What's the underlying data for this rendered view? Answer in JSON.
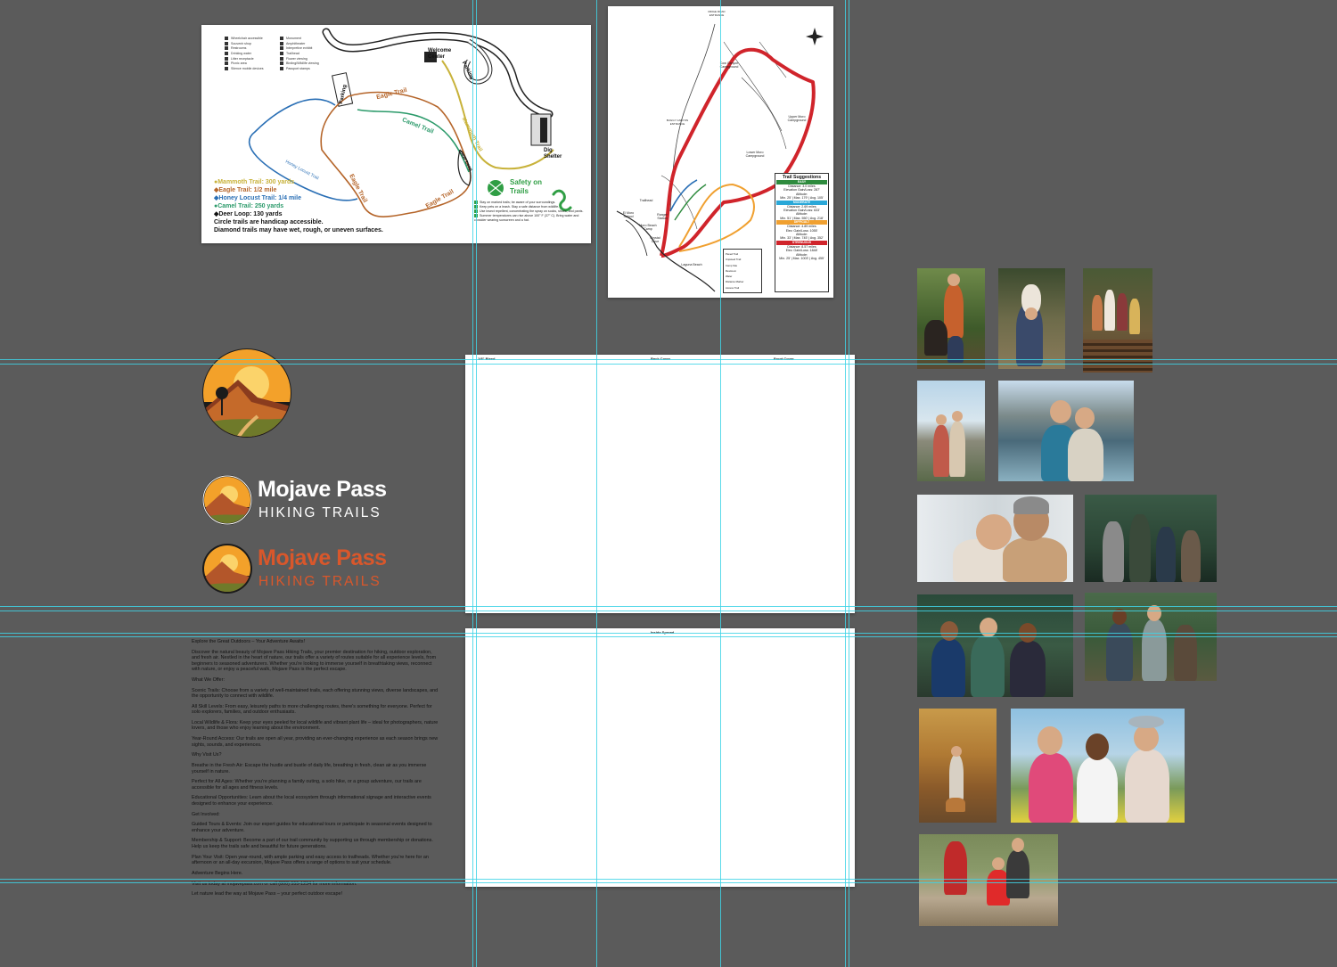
{
  "map1": {
    "legend_left": [
      "Wheelchair accessible",
      "Souvenir shop",
      "Restrooms",
      "Drinking water",
      "Litter receptacle",
      "Picnic area",
      "Silence mobile devices"
    ],
    "legend_right": [
      "Monument",
      "Amphitheater",
      "Interpretive exhibit",
      "Trailhead",
      "Flower viewing",
      "Birding/Wildlife viewing",
      "Passport stamps"
    ],
    "places": {
      "welcome": "Welcome Center",
      "parking_top": "Parking",
      "parking_left": "Parking",
      "dig_shelter": "Dig Shelter"
    },
    "trail_names": {
      "eagle_top": "Eagle Trail",
      "camel": "Camel Trail",
      "mammoth": "Mammoth Trail",
      "honey": "Honey Locust Trail",
      "eagle_mid": "Eagle Trail",
      "eagle_bottom": "Eagle Trail",
      "deer": "Deer Loop"
    },
    "trails": [
      {
        "text": "●Mammoth Trail: 300 yards",
        "color": "#c8b23a"
      },
      {
        "text": "◆Eagle Trail: 1/2 mile",
        "color": "#b5652a"
      },
      {
        "text": "◆Honey Locust Trail: 1/4 mile",
        "color": "#2a6fb5"
      },
      {
        "text": "●Camel Trail: 250 yards",
        "color": "#2b9a6a"
      },
      {
        "text": "◆Deer Loop: 130 yards",
        "color": "#111111"
      }
    ],
    "note1": "Circle trails are handicap accessible.",
    "note2": "Diamond trails may have wet, rough, or uneven surfaces.",
    "safety_title": "Safety on Trails",
    "tips": [
      "Stay on marked trails; be aware of your surroundings.",
      "Keep pets on a leash. Stay a safe distance from wildlife.",
      "Use insect repellent, concentrating the spray on socks, shoes, and pants.",
      "Summer temperatures can rise above 100° F (37° C). Bring water and consider wearing sunscreen and a hat."
    ]
  },
  "map2": {
    "labels": {
      "top_entrance": "RIDGE ROAD ENTRANCE",
      "cow_canyon": "Cow Canyon Campground",
      "buggy": "BUGGY CANYON ENTRANCE",
      "upper": "Upper Moro Campground",
      "lower": "Lower Moro Campground",
      "trailhead": "Trailhead",
      "el_moro": "El Moro School",
      "ranger": "Ranger Station",
      "moro_beach": "Moro Beach Camp",
      "crystal": "Crystal Cove",
      "laguna": "Laguna Beach"
    },
    "suggestions_title": "Trail Suggestions",
    "suggestions": [
      {
        "level": "EASY",
        "color": "#2e8b3e",
        "lines": [
          "Distance: 3.0 miles",
          "Elevation Gain/Loss: 287'",
          "Altitude:",
          "Min. 25' | Max. 179' | Avg. 105'"
        ]
      },
      {
        "level": "MODERATE",
        "color": "#2aa8d8",
        "lines": [
          "Distance: 2.69 miles",
          "Elevation Gain/Loss: 633'",
          "Altitude:",
          "Min. 51' | Max. 550' | Avg. 218'"
        ]
      },
      {
        "level": "DIFFICULT",
        "color": "#f0a030",
        "lines": [
          "Distance: 4.89 miles",
          "Elev. Gain/Loss: 1055'",
          "Altitude:",
          "Min. 33' | Max. 745' | Avg. 352'"
        ]
      },
      {
        "level": "STRENUOUS",
        "color": "#d0242b",
        "lines": [
          "Distance: 8.57 miles",
          "Elev. Gain/Loss: 1848'",
          "Altitude:",
          "Min. 25' | Max. 1003' | Avg. 455'"
        ]
      }
    ],
    "legend": [
      "Paved Trail",
      "Unpaved Trail",
      "Camp Site",
      "Restroom",
      "Water",
      "Distance Marker",
      "Access Trail"
    ]
  },
  "spread_front": {
    "left_label": "1/8\" Bleed",
    "center_label": "Back Cover",
    "right_label": "Front Cover"
  },
  "spread_inside": {
    "label": "Inside Spread"
  },
  "brand": {
    "name": "Mojave Pass",
    "tagline": "HIKING TRAILS"
  },
  "copy": [
    "Explore the Great Outdoors – Your Adventure Awaits!",
    "Discover the natural beauty of Mojave Pass Hiking Trails, your premier destination for hiking, outdoor exploration, and fresh air. Nestled in the heart of nature, our trails offer a variety of routes suitable for all experience levels, from beginners to seasoned adventurers. Whether you're looking to immerse yourself in breathtaking views, reconnect with nature, or enjoy a peaceful walk, Mojave Pass is the perfect escape.",
    "What We Offer:",
    "Scenic Trails: Choose from a variety of well-maintained trails, each offering stunning views, diverse landscapes, and the opportunity to connect with wildlife.",
    "All Skill Levels: From easy, leisurely paths to more challenging routes, there's something for everyone. Perfect for solo explorers, families, and outdoor enthusiasts.",
    "Local Wildlife & Flora: Keep your eyes peeled for local wildlife and vibrant plant life – ideal for photographers, nature lovers, and those who enjoy learning about the environment.",
    "Year-Round Access: Our trails are open all year, providing an ever-changing experience as each season brings new sights, sounds, and experiences.",
    "Why Visit Us?",
    "Breathe in the Fresh Air: Escape the hustle and bustle of daily life, breathing in fresh, clean air as you immerse yourself in nature.",
    "Perfect for All Ages: Whether you're planning a family outing, a solo hike, or a group adventure, our trails are accessible for all ages and fitness levels.",
    "Educational Opportunities: Learn about the local ecosystem through informational signage and interactive events designed to enhance your experience.",
    "Get Involved:",
    "Guided Tours & Events: Join our expert guides for educational tours or participate in seasonal events designed to enhance your adventure.",
    "Membership & Support: Become a part of our trail community by supporting us through membership or donations. Help us keep the trails safe and beautiful for future generations.",
    "Plan Your Visit: Open year-round, with ample parking and easy access to trailheads. Whether you're here for an afternoon or an all-day excursion, Mojave Pass offers a range of options to suit your schedule.",
    "Adventure Begins Here.",
    "Visit us today at mojavepass.com or call (800) 555-1234 for more information.",
    "Let nature lead the way at Mojave Pass – your perfect outdoor escape!"
  ],
  "colors": {
    "canvas": "#5b5b5b",
    "guide": "#3fd3e6",
    "brand_orange": "#d9572b",
    "brand_white": "#ffffff"
  }
}
